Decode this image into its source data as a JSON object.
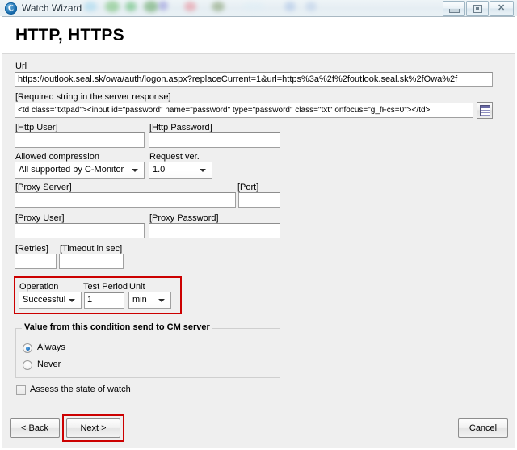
{
  "window": {
    "title": "Watch Wizard",
    "icon": "c-monitor-icon",
    "icon_glyph": "C",
    "controls": {
      "minimize": "minimize-button",
      "restore": "restore-button",
      "close": "close-button",
      "close_glyph": "✕"
    }
  },
  "header": {
    "title": "HTTP, HTTPS"
  },
  "form": {
    "url": {
      "label": "Url",
      "value": "https://outlook.seal.sk/owa/auth/logon.aspx?replaceCurrent=1&url=https%3a%2f%2foutlook.seal.sk%2fOwa%2f",
      "placeholder": ""
    },
    "required_string": {
      "label": "[Required string in the server response]",
      "value": "<td class=\"txtpad\"><input id=\"password\" name=\"password\" type=\"password\" class=\"txt\" onfocus=\"g_fFcs=0\"></td>",
      "placeholder": "",
      "picker_icon": "grid-picker-icon"
    },
    "http_user": {
      "label": "[Http User]",
      "value": "",
      "placeholder": ""
    },
    "http_password": {
      "label": "[Http Password]",
      "value": "",
      "placeholder": ""
    },
    "allowed_compression": {
      "label": "Allowed compression",
      "value": "All supported by C-Monitor",
      "options": [
        "All supported by C-Monitor"
      ]
    },
    "request_ver": {
      "label": "Request ver.",
      "value": "1.0",
      "options": [
        "1.0"
      ]
    },
    "proxy_server": {
      "label": "[Proxy Server]",
      "value": "",
      "placeholder": ""
    },
    "port": {
      "label": "[Port]",
      "value": "",
      "placeholder": ""
    },
    "proxy_user": {
      "label": "[Proxy User]",
      "value": "",
      "placeholder": ""
    },
    "proxy_password": {
      "label": "[Proxy Password]",
      "value": "",
      "placeholder": ""
    },
    "retries": {
      "label": "[Retries]",
      "value": "",
      "placeholder": ""
    },
    "timeout": {
      "label": "[Timeout in sec]",
      "value": "",
      "placeholder": ""
    },
    "operation": {
      "label": "Operation",
      "value": "Successful",
      "options": [
        "Successful"
      ]
    },
    "test_period": {
      "label": "Test Period",
      "value": "1",
      "placeholder": ""
    },
    "unit": {
      "label": "Unit",
      "value": "min",
      "options": [
        "min"
      ]
    }
  },
  "condition_group": {
    "title": "Value from this condition send to CM server",
    "options": [
      {
        "label": "Always",
        "selected": true
      },
      {
        "label": "Never",
        "selected": false
      }
    ]
  },
  "assess_checkbox": {
    "label": "Assess the state of watch",
    "checked": false
  },
  "footer": {
    "back": "< Back",
    "next": "Next >",
    "cancel": "Cancel"
  },
  "highlights": {
    "color": "#cc0000"
  }
}
